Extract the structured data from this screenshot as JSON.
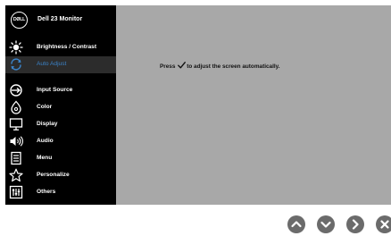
{
  "osd": {
    "logo_text": "DØLL",
    "monitor_title": "Dell 23 Monitor",
    "menu_items": [
      {
        "label": "Brightness / Contrast",
        "icon": "brightness-icon",
        "selected": false
      },
      {
        "label": "Auto Adjust",
        "icon": "auto-adjust-icon",
        "selected": true
      },
      {
        "label": "Input Source",
        "icon": "input-source-icon",
        "selected": false
      },
      {
        "label": "Color",
        "icon": "color-icon",
        "selected": false
      },
      {
        "label": "Display",
        "icon": "display-icon",
        "selected": false
      },
      {
        "label": "Audio",
        "icon": "audio-icon",
        "selected": false
      },
      {
        "label": "Menu",
        "icon": "menu-icon",
        "selected": false
      },
      {
        "label": "Personalize",
        "icon": "personalize-icon",
        "selected": false
      },
      {
        "label": "Others",
        "icon": "others-icon",
        "selected": false
      }
    ],
    "content": {
      "prefix": "Press",
      "suffix": "to adjust the screen automatically.",
      "icon": "checkmark-icon"
    }
  },
  "nav_buttons": [
    {
      "name": "up-button",
      "icon": "chevron-up-icon"
    },
    {
      "name": "down-button",
      "icon": "chevron-down-icon"
    },
    {
      "name": "right-button",
      "icon": "chevron-right-icon"
    },
    {
      "name": "close-button",
      "icon": "close-icon"
    }
  ],
  "colors": {
    "sidebar_bg": "#000000",
    "content_bg": "#a8a8a8",
    "selected_text": "#3b83c8",
    "selected_bg": "#2c2c2c",
    "button_bg": "#6b6b6b"
  }
}
